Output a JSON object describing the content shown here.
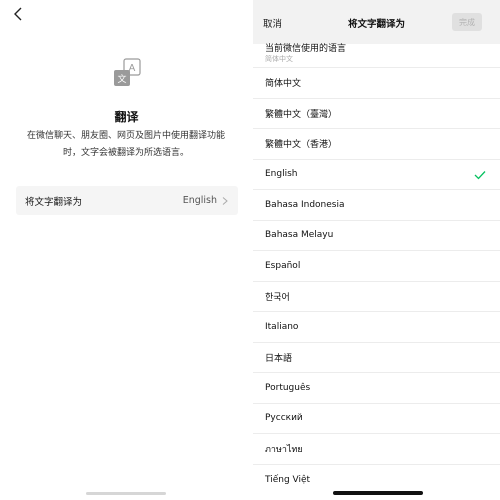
{
  "left": {
    "title": "翻译",
    "description": "在微信聊天、朋友圈、网页及图片中使用翻译功能时，文字会被翻译为所选语言。",
    "target_row": {
      "label": "将文字翻译为",
      "value": "English"
    }
  },
  "right": {
    "header": {
      "cancel": "取消",
      "title": "将文字翻译为",
      "done": "完成"
    },
    "current": {
      "label": "当前微信使用的语言",
      "value": "简体中文"
    },
    "languages": [
      {
        "label": "简体中文",
        "selected": false
      },
      {
        "label": "繁體中文（臺灣）",
        "selected": false
      },
      {
        "label": "繁體中文（香港）",
        "selected": false
      },
      {
        "label": "English",
        "selected": true
      },
      {
        "label": "Bahasa Indonesia",
        "selected": false
      },
      {
        "label": "Bahasa Melayu",
        "selected": false
      },
      {
        "label": "Español",
        "selected": false
      },
      {
        "label": "한국어",
        "selected": false
      },
      {
        "label": "Italiano",
        "selected": false
      },
      {
        "label": "日本語",
        "selected": false
      },
      {
        "label": "Português",
        "selected": false
      },
      {
        "label": "Русский",
        "selected": false
      },
      {
        "label": "ภาษาไทย",
        "selected": false
      },
      {
        "label": "Tiếng Việt",
        "selected": false
      }
    ]
  },
  "colors": {
    "check": "#07c160",
    "header_bg": "#f2f2f2",
    "row_bg": "#f5f5f5"
  },
  "icons": {
    "back": "chevron-left-icon",
    "logo": "translate-icon",
    "row_arrow": "chevron-right-icon",
    "selected": "check-icon"
  }
}
